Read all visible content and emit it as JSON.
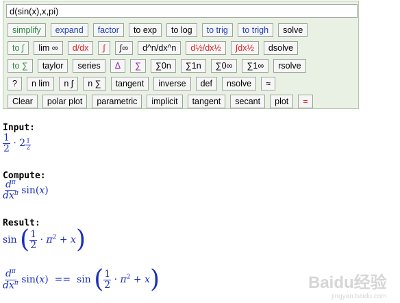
{
  "input_field": {
    "value": "d(sin(x),x,pi)"
  },
  "rows": [
    [
      {
        "label": "simplify",
        "color": "green"
      },
      {
        "label": "expand",
        "color": "blue"
      },
      {
        "label": "factor",
        "color": "blue"
      },
      {
        "label": "to exp",
        "color": "black"
      },
      {
        "label": "to log",
        "color": "black"
      },
      {
        "label": "to trig",
        "color": "blue"
      },
      {
        "label": "to trigh",
        "color": "blue"
      },
      {
        "label": "solve",
        "color": "black"
      }
    ],
    [
      {
        "label": "to ∫",
        "color": "green"
      },
      {
        "label": "lim ∞",
        "color": "black"
      },
      {
        "label": "d/dx",
        "color": "red"
      },
      {
        "label": "∫",
        "color": "red"
      },
      {
        "label": "∫∞",
        "color": "black"
      },
      {
        "label": "d^n/dx^n",
        "color": "black"
      },
      {
        "label": "d½/dx½",
        "color": "red"
      },
      {
        "label": "∫dx½",
        "color": "red"
      },
      {
        "label": "dsolve",
        "color": "black"
      }
    ],
    [
      {
        "label": "to ∑",
        "color": "green"
      },
      {
        "label": "taylor",
        "color": "black"
      },
      {
        "label": "series",
        "color": "black"
      },
      {
        "label": "Δ",
        "color": "purple"
      },
      {
        "label": "∑",
        "color": "purple"
      },
      {
        "label": "∑0n",
        "color": "black"
      },
      {
        "label": "∑1n",
        "color": "black"
      },
      {
        "label": "∑0∞",
        "color": "black"
      },
      {
        "label": "∑1∞",
        "color": "black"
      },
      {
        "label": "rsolve",
        "color": "black"
      }
    ],
    [
      {
        "label": "?",
        "color": "black"
      },
      {
        "label": "n lim",
        "color": "black"
      },
      {
        "label": "n ∫",
        "color": "black"
      },
      {
        "label": "n ∑",
        "color": "black"
      },
      {
        "label": "tangent",
        "color": "black"
      },
      {
        "label": "inverse",
        "color": "black"
      },
      {
        "label": "def",
        "color": "black"
      },
      {
        "label": "nsolve",
        "color": "black"
      },
      {
        "label": "≈",
        "color": "black"
      }
    ],
    [
      {
        "label": "Clear",
        "color": "black"
      },
      {
        "label": "polar plot",
        "color": "black"
      },
      {
        "label": "parametric",
        "color": "black"
      },
      {
        "label": "implicit",
        "color": "black"
      },
      {
        "label": "tangent",
        "color": "black"
      },
      {
        "label": "secant",
        "color": "black"
      },
      {
        "label": "plot",
        "color": "black"
      },
      {
        "label": "=",
        "color": "red"
      }
    ]
  ],
  "output": {
    "input_label": "Input:",
    "compute_label": "Compute:",
    "result_label": "Result:",
    "one": "1",
    "two": "2",
    "dot": "·",
    "plus": "+",
    "x": "x",
    "pi": "π",
    "d": "d",
    "dx": "dx",
    "sin": "sin",
    "equals": "=="
  },
  "watermark": {
    "brand": "Baidu经验",
    "url": "jingyan.baidu.com"
  }
}
